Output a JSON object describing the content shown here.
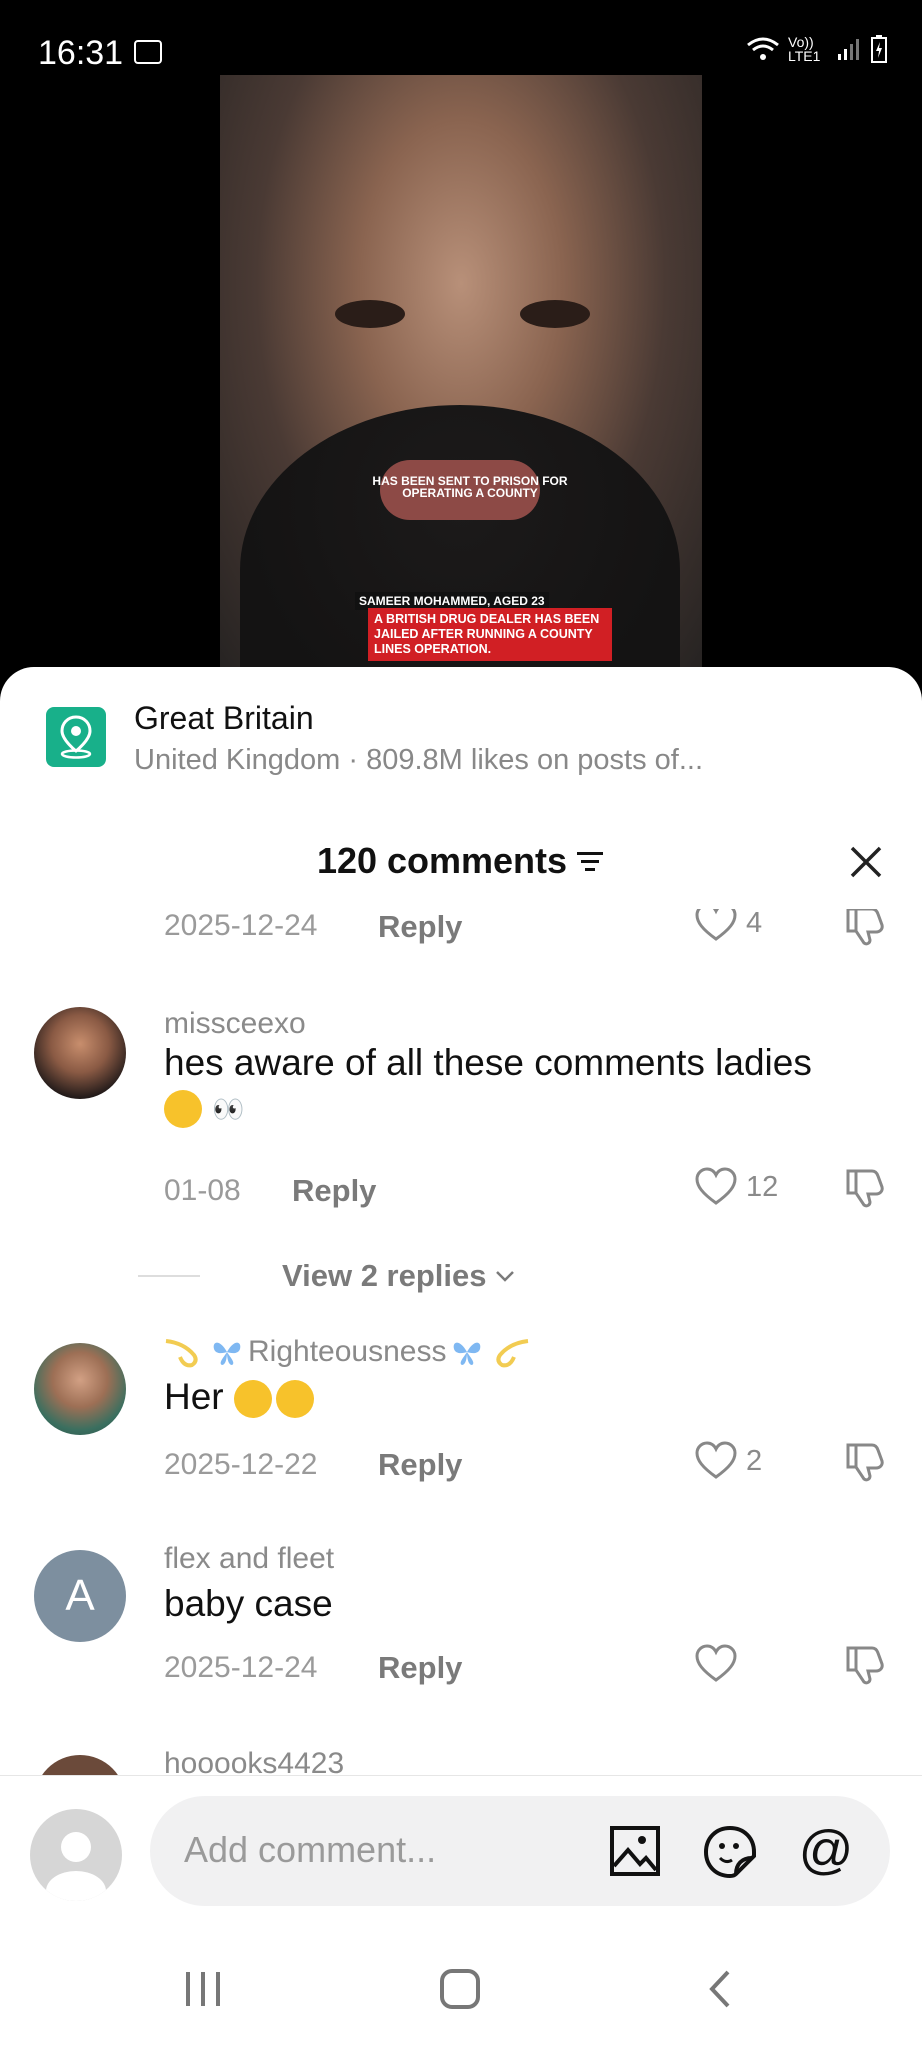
{
  "status": {
    "time": "16:31",
    "network": "Vo)) LTE1"
  },
  "video": {
    "caption_top": "HAS BEEN SENT TO PRISON FOR OPERATING A COUNTY",
    "caption_name": "SAMEER MOHAMMED, AGED 23",
    "caption_red": "A BRITISH DRUG DEALER HAS BEEN JAILED AFTER RUNNING A COUNTY LINES OPERATION."
  },
  "location": {
    "title": "Great Britain",
    "subtitle": "United Kingdom · 809.8M likes on posts of..."
  },
  "comments_header": {
    "count_label": "120 comments"
  },
  "partial_row": {
    "date": "2025-12-24",
    "reply": "Reply",
    "likes": "4"
  },
  "comments": [
    {
      "username": "missceexo",
      "text": "hes aware of all these comments ladies",
      "date": "01-08",
      "reply": "Reply",
      "likes": "12",
      "view_replies": "View 2 replies"
    },
    {
      "username": "Righteousness",
      "text": "Her",
      "date": "2025-12-22",
      "reply": "Reply",
      "likes": "2"
    },
    {
      "username": "flex and fleet",
      "avatar_letter": "A",
      "text": "baby case",
      "date": "2025-12-24",
      "reply": "Reply",
      "likes": ""
    },
    {
      "username": "hooooks4423"
    }
  ],
  "composer": {
    "placeholder": "Add comment..."
  },
  "icons": [
    "image-icon",
    "sticker-icon",
    "mention-icon",
    "heart-icon",
    "dislike-icon",
    "close-icon",
    "filter-icon",
    "location-pin-icon"
  ]
}
